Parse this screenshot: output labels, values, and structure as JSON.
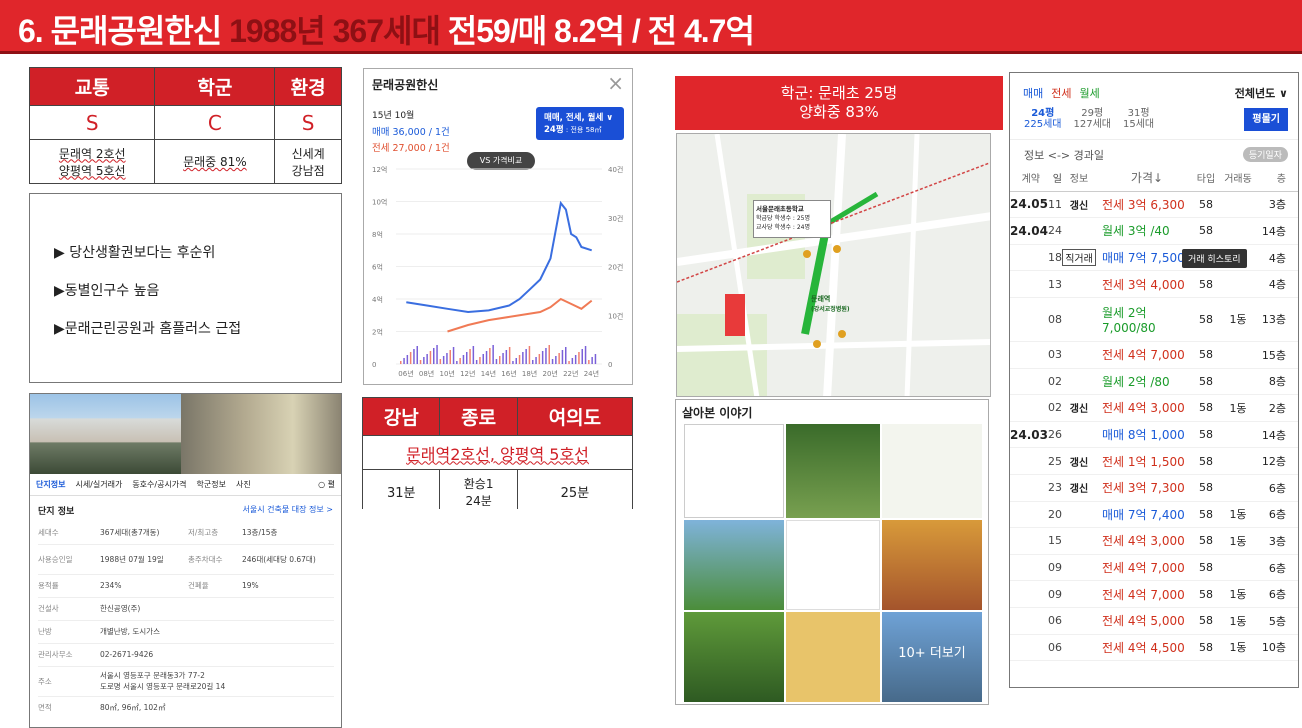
{
  "header": {
    "title_a": "6. 문래공원한신 ",
    "title_b": "1988년 367세대",
    "title_c": " 전59/매 8.2억 / 전 4.7억"
  },
  "grades": {
    "cols": [
      "교통",
      "학군",
      "환경"
    ],
    "grades": [
      "S",
      "C",
      "S"
    ],
    "notes": [
      [
        "문래역 2호선",
        "양평역 5호선"
      ],
      [
        "문래중 81%"
      ],
      [
        "신세계",
        "강남점"
      ]
    ]
  },
  "bullets": [
    "▶ 당산생활권보다는 후순위",
    "▶동별인구수 높음",
    "▶문래근린공원과 홈플러스 근접"
  ],
  "price_panel": {
    "name": "문래공원한신",
    "period": "15년 10월",
    "sale": "매매 36,000 / 1건",
    "jeonse": "전세 27,000 / 1건",
    "filter_line1": "매매, 전세, 월세 ∨",
    "filter_line2": "24평",
    "filter_sub": " : 전용 58㎡",
    "compare": "VS 가격비교",
    "close": "×"
  },
  "chart_data": {
    "type": "line",
    "title": "",
    "x_ticks": [
      "06년",
      "08년",
      "10년",
      "12년",
      "14년",
      "16년",
      "18년",
      "20년",
      "22년",
      "24년"
    ],
    "y_left": [
      "0",
      "2억",
      "4억",
      "6억",
      "8억",
      "10억",
      "12억"
    ],
    "y_right": [
      "0",
      "10건",
      "20건",
      "30건",
      "40건"
    ],
    "series": [
      {
        "name": "매매",
        "color": "#3a6ee0",
        "x": [
          2006,
          2008,
          2010,
          2012,
          2014,
          2016,
          2017,
          2018,
          2019,
          2020,
          2021,
          2021.5,
          2022,
          2022.5,
          2023,
          2024
        ],
        "y": [
          3.8,
          3.6,
          3.4,
          3.2,
          3.3,
          3.6,
          4.0,
          4.6,
          5.2,
          6.5,
          9.9,
          9.5,
          8.0,
          7.8,
          7.2,
          7.0
        ]
      },
      {
        "name": "전세",
        "color": "#f07a55",
        "x": [
          2010,
          2012,
          2014,
          2016,
          2017,
          2018,
          2019,
          2020,
          2021,
          2022,
          2023,
          2024
        ],
        "y": [
          2.0,
          2.4,
          2.7,
          2.9,
          3.0,
          3.1,
          3.2,
          3.5,
          4.0,
          3.7,
          3.4,
          3.9
        ]
      }
    ]
  },
  "commute": {
    "cols": [
      "강남",
      "종로",
      "여의도"
    ],
    "stations": "문래역2호선, 양평역 5호선",
    "times": [
      "31분",
      "환승1\n24분",
      "25분"
    ]
  },
  "school": {
    "line1": "학군: 문래초 25명",
    "line2": "양화중 83%"
  },
  "map": {
    "school_popup": [
      "서울문래초등학교",
      "학급당 학생수 : 25명",
      "교사당 학생수 : 24명"
    ],
    "stn": "문래역",
    "stn_sub": "(강서교정병원)"
  },
  "story": {
    "title": "살아본 이야기",
    "more": "10+ 더보기"
  },
  "complex": {
    "tabs": [
      "단지정보",
      "시세/실거래가",
      "동호수/공시가격",
      "학군정보",
      "사진"
    ],
    "more": "○ 펼",
    "section": "단지 정보",
    "link": "서울시 건축물 대장 정보 >",
    "rows": [
      [
        "세대수",
        "367세대(총7개동)",
        "저/최고층",
        "13층/15층"
      ],
      [
        "사용승인일",
        "1988년 07월 19일",
        "총주차대수",
        "246대(세대당 0.67대)"
      ],
      [
        "용적률",
        "234%",
        "건폐율",
        "19%"
      ],
      [
        "건설사",
        "한신공영(주)",
        "",
        ""
      ],
      [
        "난방",
        "개별난방, 도시가스",
        "",
        ""
      ],
      [
        "관리사무소",
        "02-2671-9426",
        "",
        ""
      ],
      [
        "주소",
        "서울시 영등포구 문래동3가 77-2",
        "",
        ""
      ],
      [
        "",
        "도로명 서울시 영등포구 문래로20길 14",
        "",
        ""
      ],
      [
        "면적",
        "80㎡, 96㎡, 102㎡",
        "",
        ""
      ]
    ]
  },
  "listing": {
    "tabs": [
      "매매",
      "전세",
      "월세"
    ],
    "year": "전체년도 ∨",
    "sizes": [
      {
        "p": "24평",
        "h": "225세대"
      },
      {
        "p": "29평",
        "h": "127세대"
      },
      {
        "p": "31평",
        "h": "15세대"
      }
    ],
    "size_btn": "평몰기",
    "info": "정보 <-> 경과일",
    "reg_btn": "등기일자",
    "cols": [
      "계약",
      "일",
      "정보",
      "가격↓",
      "타입",
      "거래동",
      "층"
    ],
    "tooltip": "거래 히스토리",
    "rows": [
      [
        "24.05",
        "11",
        "갱신",
        "전세 3억 6,300",
        "58",
        "",
        "3층"
      ],
      [
        "24.04",
        "24",
        "",
        "월세 3억 /40",
        "58",
        "",
        "14층"
      ],
      [
        "",
        "18",
        "직거래",
        "매매 7억 7,500",
        "58",
        "",
        "4층"
      ],
      [
        "",
        "13",
        "",
        "전세 3억 4,000",
        "58",
        "",
        "4층"
      ],
      [
        "",
        "08",
        "",
        "월세 2억 7,000/80",
        "58",
        "1동",
        "13층"
      ],
      [
        "",
        "03",
        "",
        "전세 4억 7,000",
        "58",
        "",
        "15층"
      ],
      [
        "",
        "02",
        "",
        "월세 2억 /80",
        "58",
        "",
        "8층"
      ],
      [
        "",
        "02",
        "갱신",
        "전세 4억 3,000",
        "58",
        "1동",
        "2층"
      ],
      [
        "24.03",
        "26",
        "",
        "매매 8억 1,000",
        "58",
        "",
        "14층"
      ],
      [
        "",
        "25",
        "갱신",
        "전세 1억 1,500",
        "58",
        "",
        "12층"
      ],
      [
        "",
        "23",
        "갱신",
        "전세 3억 7,300",
        "58",
        "",
        "6층"
      ],
      [
        "",
        "20",
        "",
        "매매 7억 7,400",
        "58",
        "1동",
        "6층"
      ],
      [
        "",
        "15",
        "",
        "전세 4억 3,000",
        "58",
        "1동",
        "3층"
      ],
      [
        "",
        "09",
        "",
        "전세 4억 7,000",
        "58",
        "",
        "6층"
      ],
      [
        "",
        "09",
        "",
        "전세 4억 7,000",
        "58",
        "1동",
        "6층"
      ],
      [
        "",
        "06",
        "",
        "전세 4억 5,000",
        "58",
        "1동",
        "5층"
      ],
      [
        "",
        "06",
        "",
        "전세 4억 4,500",
        "58",
        "1동",
        "10층"
      ]
    ]
  },
  "colors": {
    "red": "#e0262b",
    "dark_red": "#8e1014",
    "sale": "#1a5ad8",
    "jeonse": "#d0301c",
    "wolse": "#1a9b2a"
  }
}
